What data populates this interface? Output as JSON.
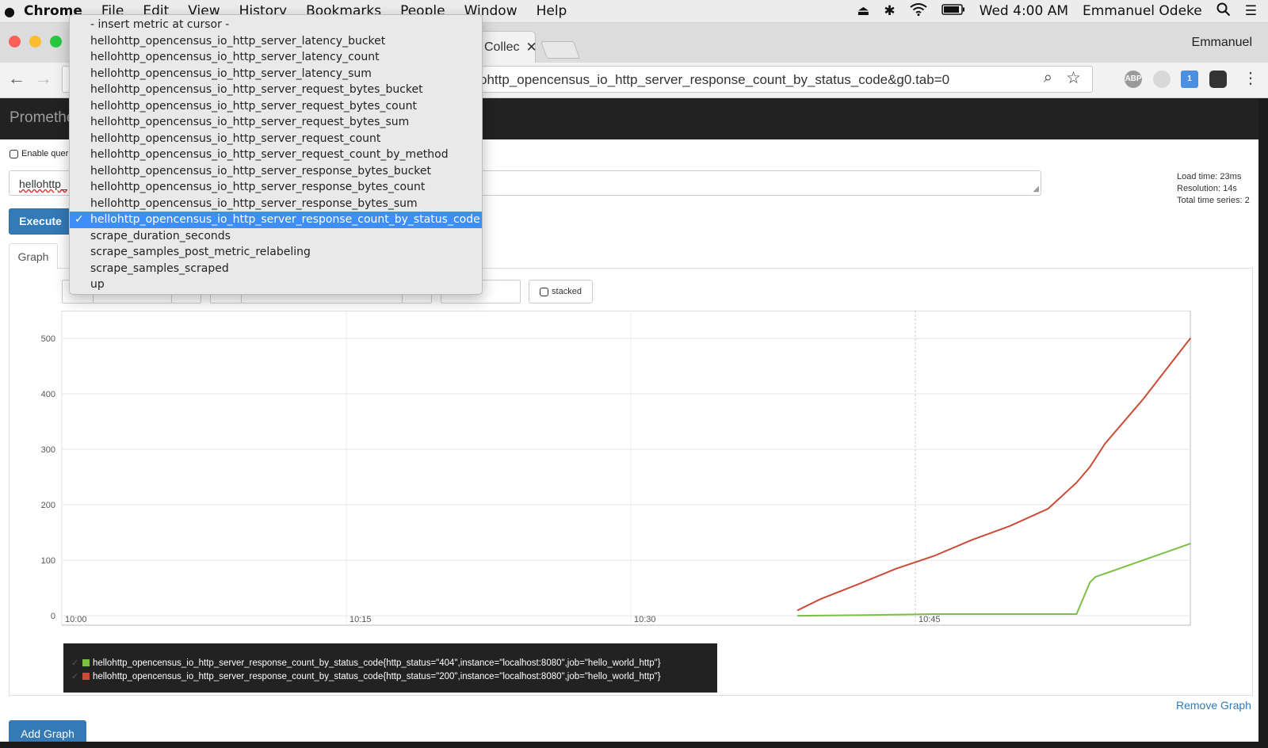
{
  "menubar": {
    "app": "Chrome",
    "items": [
      "File",
      "Edit",
      "View",
      "History",
      "Bookmarks",
      "People",
      "Window",
      "Help"
    ],
    "clock": "Wed 4:00 AM",
    "user": "Emmanuel Odeke"
  },
  "browser": {
    "tab_title": "Collec",
    "profile": "Emmanuel",
    "url": "ohttp_opencensus_io_http_server_response_count_by_status_code&g0.tab=0",
    "ext_abp": "ABP",
    "ext_badge": "1"
  },
  "prometheus": {
    "brand": "Promethe",
    "enable_query_history": "Enable quer",
    "expression_value": "hellohttp_",
    "execute": "Execute",
    "stats": {
      "load_time": "Load time: 23ms",
      "resolution": "Resolution: 14s",
      "total_series": "Total time series: 2"
    },
    "tab_graph": "Graph",
    "stacked": "stacked",
    "remove_graph": "Remove Graph",
    "add_graph": "Add Graph"
  },
  "dropdown": {
    "items": [
      "- insert metric at cursor -",
      "hellohttp_opencensus_io_http_server_latency_bucket",
      "hellohttp_opencensus_io_http_server_latency_count",
      "hellohttp_opencensus_io_http_server_latency_sum",
      "hellohttp_opencensus_io_http_server_request_bytes_bucket",
      "hellohttp_opencensus_io_http_server_request_bytes_count",
      "hellohttp_opencensus_io_http_server_request_bytes_sum",
      "hellohttp_opencensus_io_http_server_request_count",
      "hellohttp_opencensus_io_http_server_request_count_by_method",
      "hellohttp_opencensus_io_http_server_response_bytes_bucket",
      "hellohttp_opencensus_io_http_server_response_bytes_count",
      "hellohttp_opencensus_io_http_server_response_bytes_sum",
      "hellohttp_opencensus_io_http_server_response_count_by_status_code",
      "scrape_duration_seconds",
      "scrape_samples_post_metric_relabeling",
      "scrape_samples_scraped",
      "up"
    ],
    "selected_index": 12,
    "check_glyph": "✓"
  },
  "colors": {
    "series_404": "#7bc043",
    "series_200": "#cc4b37",
    "primary": "#337ab7",
    "navbar": "#222222",
    "dropdown_selected": "#3d8ef7"
  },
  "chart_data": {
    "type": "line",
    "x_ticks": [
      "10:00",
      "10:15",
      "10:30",
      "10:45"
    ],
    "y_ticks": [
      "0",
      "100",
      "200",
      "300",
      "400",
      "500"
    ],
    "xlim_minutes_after_10": [
      0,
      59.5
    ],
    "ylim": [
      -17,
      550
    ],
    "series": [
      {
        "name": "hellohttp_opencensus_io_http_server_response_count_by_status_code{http_status=\"404\",instance=\"localhost:8080\",job=\"hello_world_http\"}",
        "color": "#7bc043",
        "x_minutes_after_10": [
          38.8,
          42,
          46,
          50,
          53.5,
          54.2,
          54.5,
          57,
          59.5
        ],
        "values": [
          0,
          1,
          3,
          3,
          3,
          60,
          70,
          100,
          130
        ]
      },
      {
        "name": "hellohttp_opencensus_io_http_server_response_count_by_status_code{http_status=\"200\",instance=\"localhost:8080\",job=\"hello_world_http\"}",
        "color": "#cc4b37",
        "x_minutes_after_10": [
          38.8,
          40,
          42,
          44,
          46,
          48,
          50,
          52,
          53.5,
          54.2,
          55,
          57,
          59.5
        ],
        "values": [
          10,
          30,
          57,
          85,
          108,
          137,
          162,
          193,
          240,
          268,
          310,
          390,
          500
        ]
      }
    ]
  }
}
